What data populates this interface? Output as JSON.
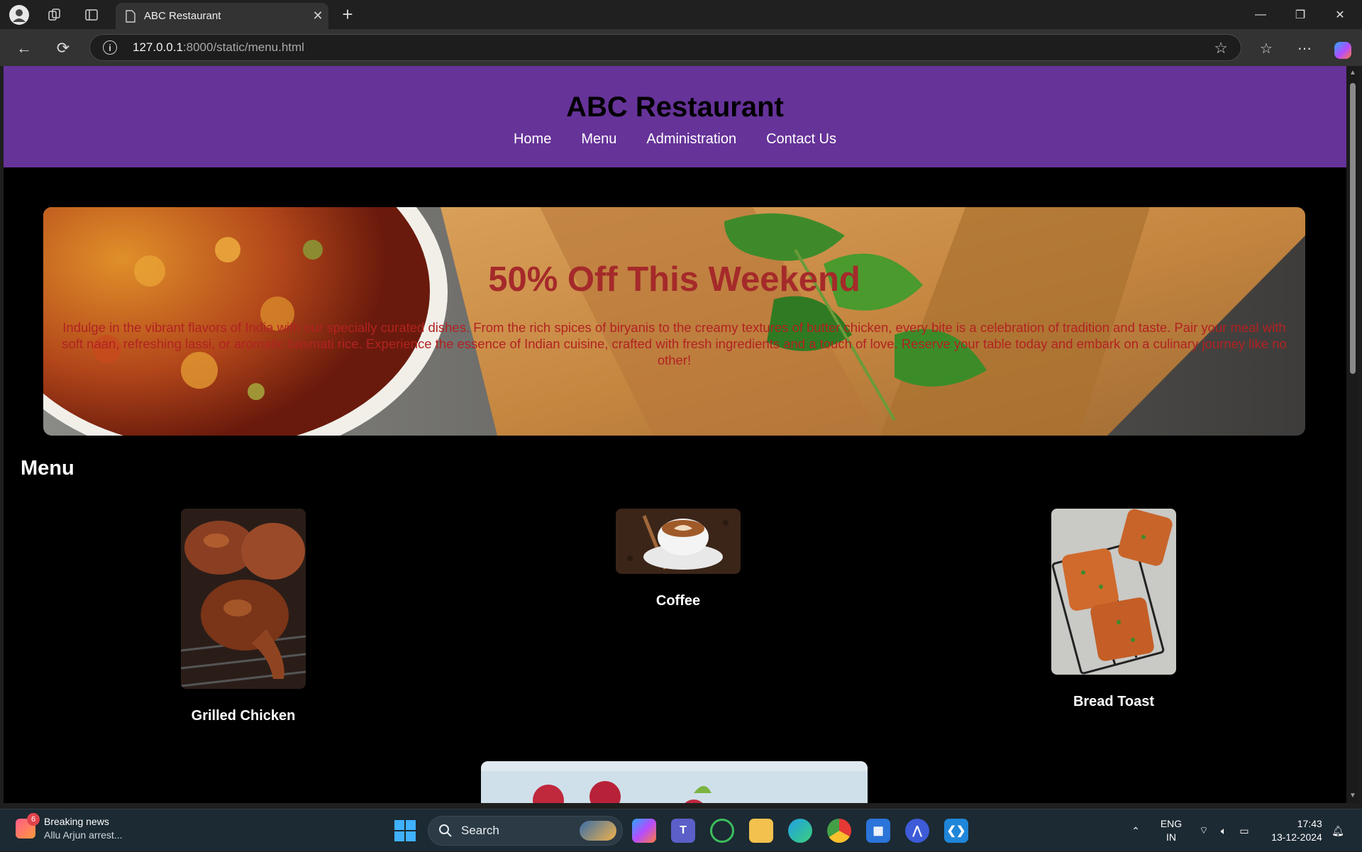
{
  "browser": {
    "tab_title": "ABC Restaurant",
    "url_host": "127.0.0.1",
    "url_rest": ":8000/static/menu.html"
  },
  "site": {
    "title": "ABC Restaurant",
    "nav": [
      "Home",
      "Menu",
      "Administration",
      "Contact Us"
    ]
  },
  "hero": {
    "title": "50% Off This Weekend",
    "text": "Indulge in the vibrant flavors of India with our specially curated dishes. From the rich spices of biryanis to the creamy textures of butter chicken, every bite is a celebration of tradition and taste. Pair your meal with soft naan, refreshing lassi, or aromatic basmati rice. Experience the essence of Indian cuisine, crafted with fresh ingredients and a touch of love. Reserve your table today and embark on a culinary journey like no other!"
  },
  "menu": {
    "heading": "Menu",
    "items": [
      {
        "name": "Grilled Chicken"
      },
      {
        "name": "Coffee"
      },
      {
        "name": "Bread Toast"
      }
    ]
  },
  "taskbar": {
    "news_badge": "6",
    "news_title": "Breaking news",
    "news_sub": "Allu Arjun arrest...",
    "search_label": "Search",
    "lang_1": "ENG",
    "lang_2": "IN",
    "time": "17:43",
    "date": "13-12-2024"
  },
  "colors": {
    "header_bg": "#663399",
    "hero_title": "#a52a2a",
    "page_bg": "#000000"
  }
}
